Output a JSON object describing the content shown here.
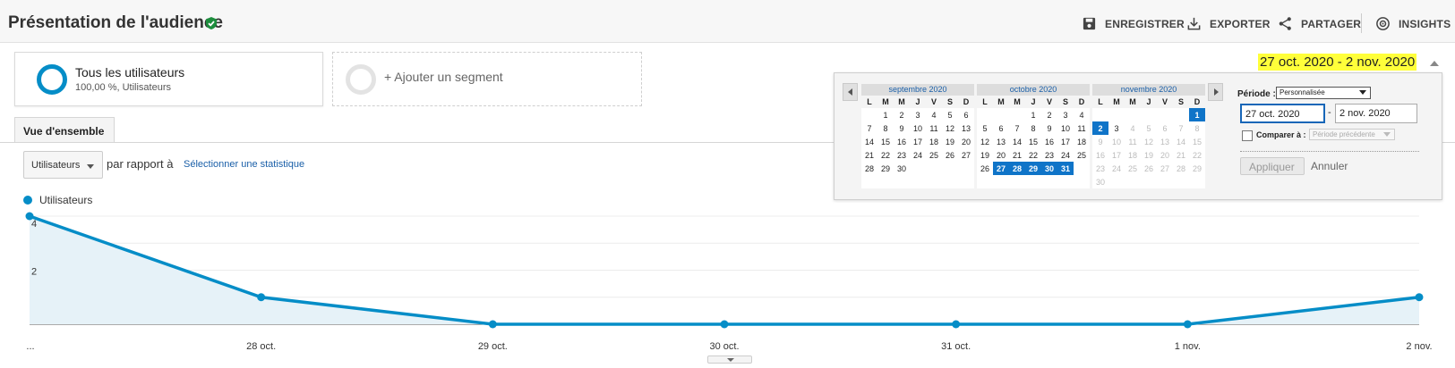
{
  "header": {
    "title": "Présentation de l'audience",
    "actions": [
      {
        "label": "ENREGISTRER",
        "icon": "save-icon"
      },
      {
        "label": "EXPORTER",
        "icon": "download-icon"
      },
      {
        "label": "PARTAGER",
        "icon": "share-icon"
      },
      {
        "label": "INSIGHTS",
        "icon": "insights-icon"
      }
    ],
    "verified_color": "#1e8e3e"
  },
  "segments": {
    "active": {
      "title": "Tous les utilisateurs",
      "subtitle": "100,00 %, Utilisateurs"
    },
    "add_label": "+ Ajouter un segment"
  },
  "tabs": [
    {
      "label": "Vue d'ensemble",
      "active": true
    }
  ],
  "controls": {
    "metric": "Utilisateurs",
    "compare_text": "par rapport à",
    "select_stat": "Sélectionner une statistique"
  },
  "date_range": {
    "label": "27 oct. 2020 - 2 nov. 2020",
    "period_label": "Période :",
    "period_value": "Personnalisée",
    "start": "27 oct. 2020",
    "dash": "-",
    "end": "2 nov. 2020",
    "compare_label": "Comparer à :",
    "compare_value": "Période précédente",
    "apply": "Appliquer",
    "cancel": "Annuler",
    "weekdays": [
      "L",
      "M",
      "M",
      "J",
      "V",
      "S",
      "D"
    ],
    "months": [
      {
        "name": "septembre 2020",
        "start_offset": 1,
        "days": 30,
        "selected": [],
        "future_from": 0
      },
      {
        "name": "octobre 2020",
        "start_offset": 3,
        "days": 31,
        "selected": [
          27,
          28,
          29,
          30,
          31
        ],
        "future_from": 0
      },
      {
        "name": "novembre 2020",
        "start_offset": 6,
        "days": 30,
        "selected": [
          1,
          2
        ],
        "future_from": 4
      }
    ]
  },
  "chart_data": {
    "type": "area",
    "legend": "Utilisateurs",
    "categories": [
      "...",
      "28 oct.",
      "29 oct.",
      "30 oct.",
      "31 oct.",
      "1 nov.",
      "2 nov."
    ],
    "series": [
      {
        "name": "Utilisateurs",
        "values": [
          4,
          1,
          0,
          0,
          0,
          0,
          1
        ]
      }
    ],
    "y_ticks": [
      2,
      4
    ],
    "ylim": [
      0,
      4
    ],
    "line_color": "#058dc7",
    "fill_color": "#e6f2f8",
    "grid": true
  }
}
